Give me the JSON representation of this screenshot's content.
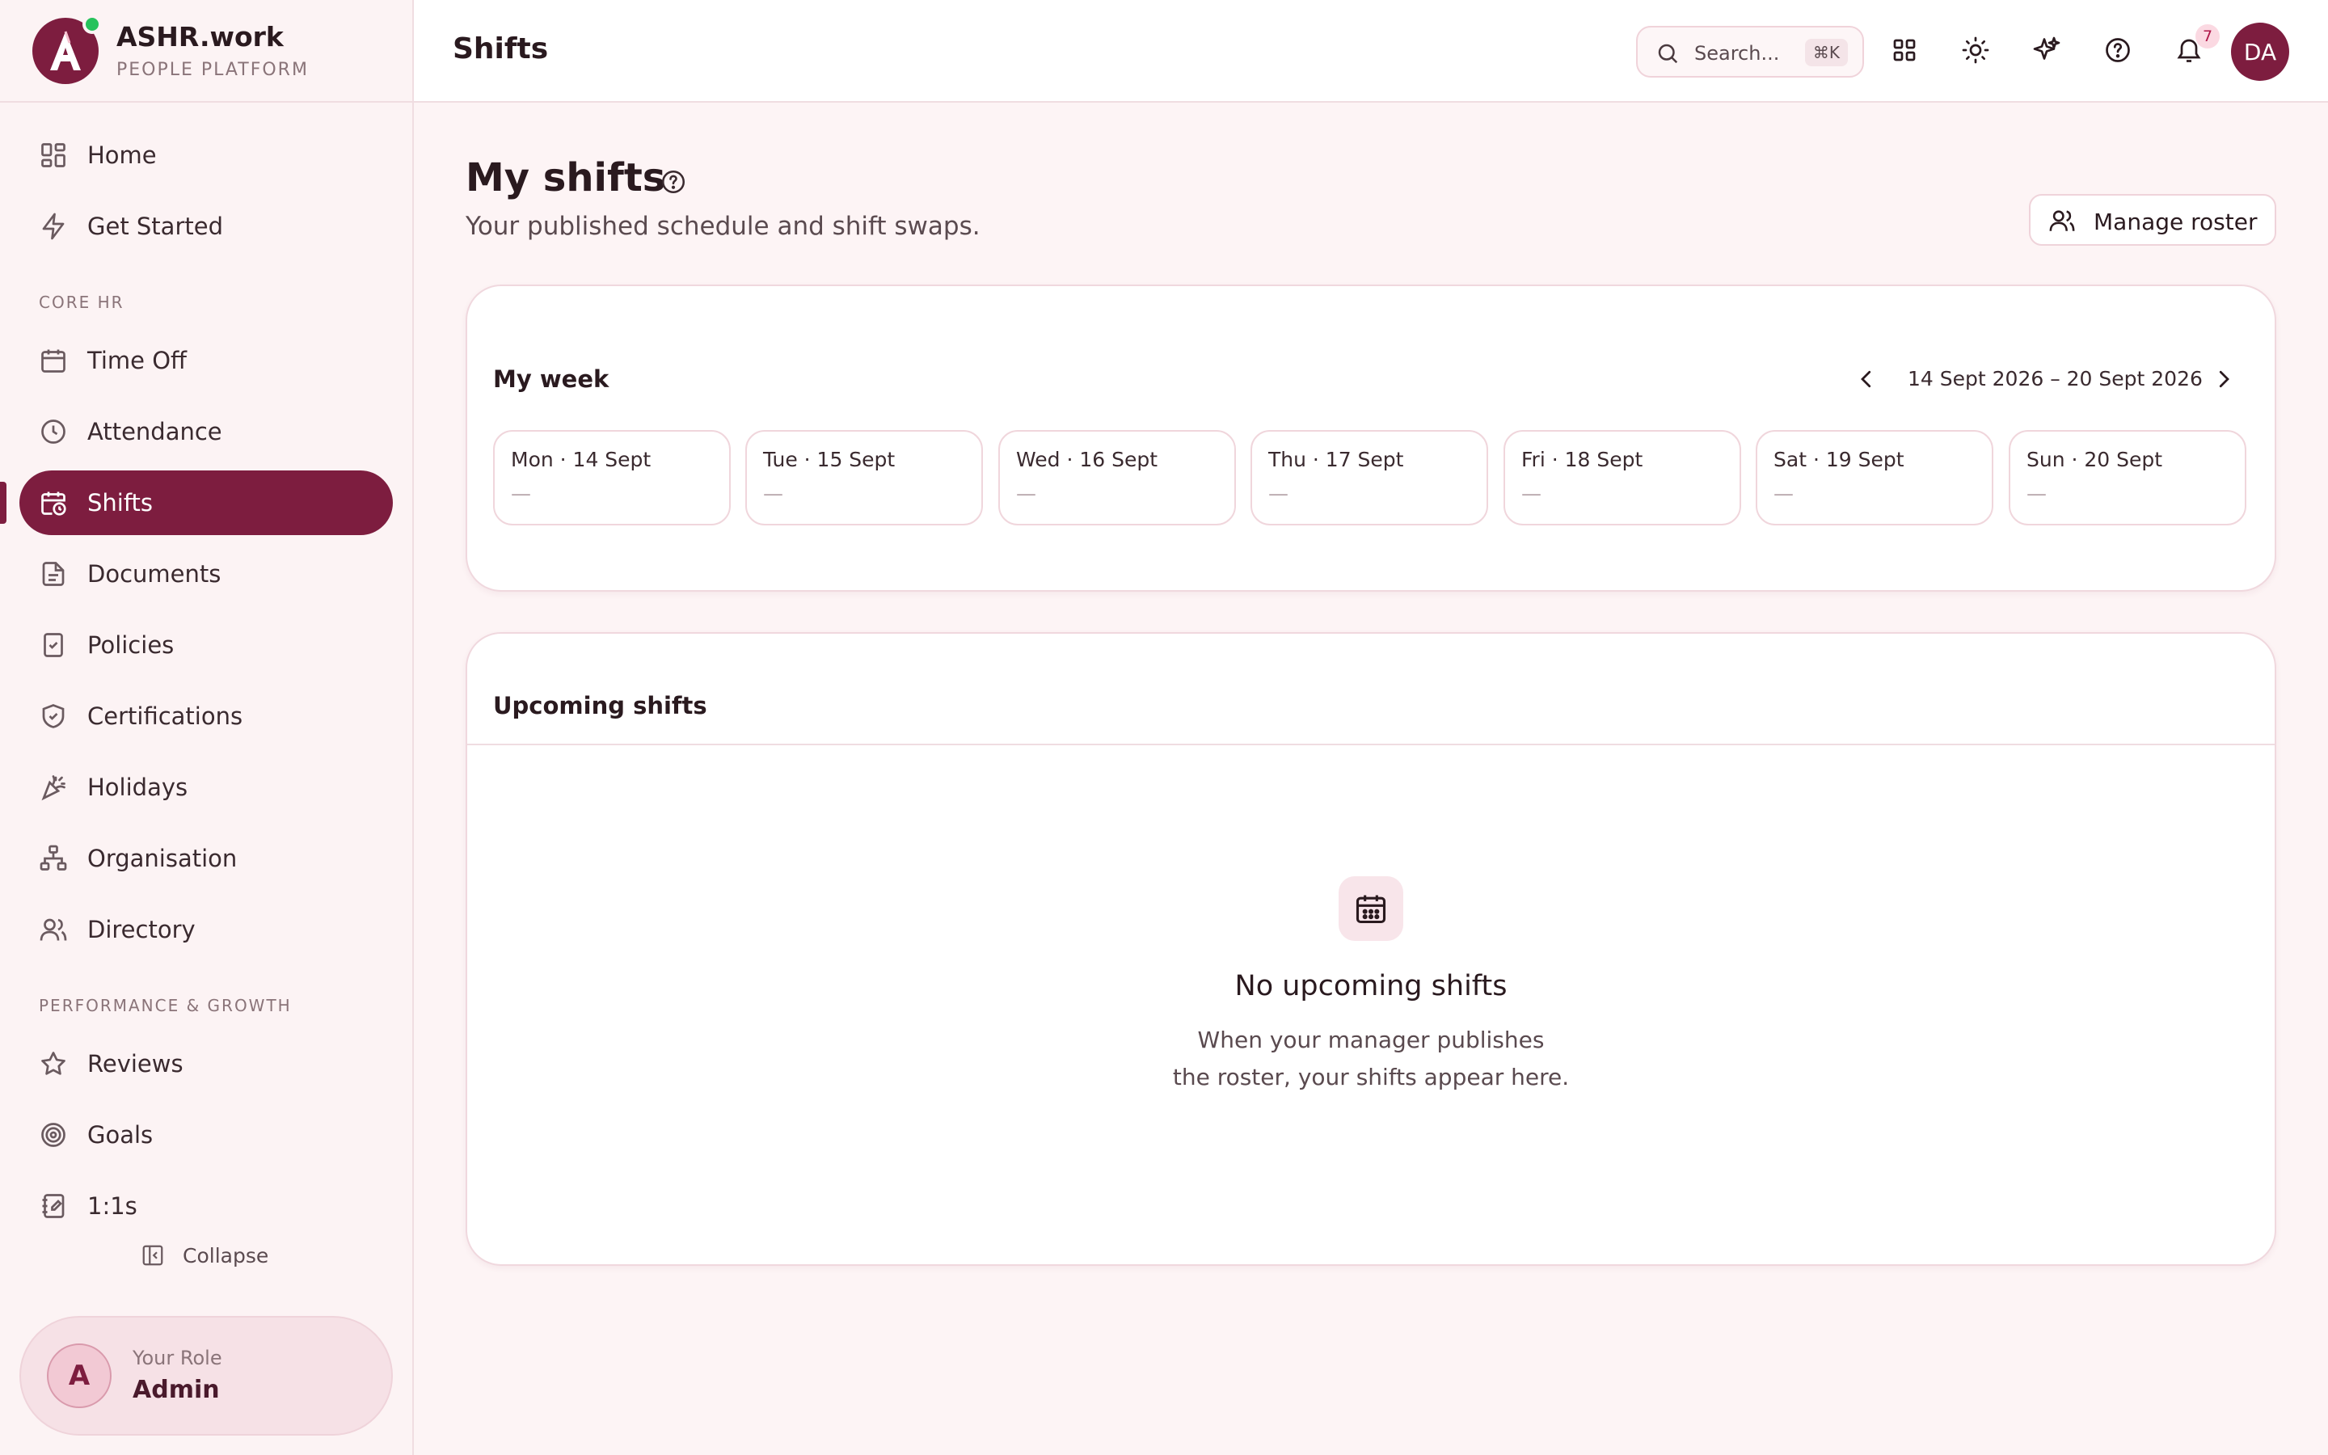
{
  "brand": {
    "name": "ASHR.work",
    "subtitle": "PEOPLE PLATFORM",
    "logo_letter": "A"
  },
  "sidebar": {
    "top_items": [
      {
        "label": "Home",
        "icon": "grid-icon"
      },
      {
        "label": "Get Started",
        "icon": "bolt-icon"
      }
    ],
    "core_hr_label": "CORE HR",
    "core_hr_items": [
      {
        "label": "Time Off",
        "icon": "calendar-icon"
      },
      {
        "label": "Attendance",
        "icon": "clock-icon"
      },
      {
        "label": "Shifts",
        "icon": "calendar-clock-icon",
        "active": true
      },
      {
        "label": "Documents",
        "icon": "document-icon"
      },
      {
        "label": "Policies",
        "icon": "clipboard-check-icon"
      },
      {
        "label": "Certifications",
        "icon": "shield-check-icon"
      },
      {
        "label": "Holidays",
        "icon": "party-popper-icon"
      },
      {
        "label": "Organisation",
        "icon": "org-chart-icon"
      },
      {
        "label": "Directory",
        "icon": "users-icon"
      }
    ],
    "perf_label": "PERFORMANCE & GROWTH",
    "perf_items": [
      {
        "label": "Reviews",
        "icon": "star-icon"
      },
      {
        "label": "Goals",
        "icon": "target-icon"
      },
      {
        "label": "1:1s",
        "icon": "notebook-icon"
      }
    ],
    "collapse_label": "Collapse",
    "role": {
      "avatar_letter": "A",
      "label": "Your Role",
      "value": "Admin"
    }
  },
  "header": {
    "title": "Shifts",
    "search_placeholder": "Search...",
    "search_shortcut": "⌘K",
    "notification_count": "7",
    "avatar_initials": "DA"
  },
  "main": {
    "title": "My shifts",
    "subtitle": "Your published schedule and shift swaps.",
    "manage_label": "Manage roster",
    "week": {
      "title": "My week",
      "range": "14 Sept 2026 – 20 Sept 2026",
      "days": [
        {
          "name": "Mon · 14 Sept",
          "value": "—"
        },
        {
          "name": "Tue · 15 Sept",
          "value": "—"
        },
        {
          "name": "Wed · 16 Sept",
          "value": "—"
        },
        {
          "name": "Thu · 17 Sept",
          "value": "—"
        },
        {
          "name": "Fri · 18 Sept",
          "value": "—"
        },
        {
          "name": "Sat · 19 Sept",
          "value": "—"
        },
        {
          "name": "Sun · 20 Sept",
          "value": "—"
        }
      ]
    },
    "upcoming": {
      "title": "Upcoming shifts",
      "empty_title": "No upcoming shifts",
      "empty_line1": "When your manager publishes",
      "empty_line2": "the roster, your shifts appear here."
    }
  },
  "colors": {
    "brand": "#7d1d3f",
    "online": "#27c25c",
    "background": "#fdf4f5"
  }
}
